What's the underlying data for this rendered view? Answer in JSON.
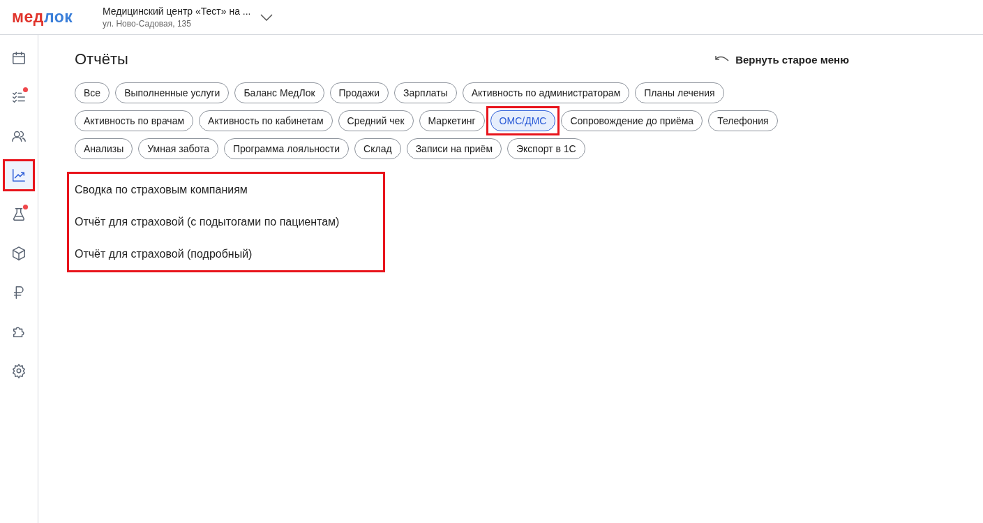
{
  "header": {
    "logo": {
      "part_1": "мед",
      "part_2": "лок"
    },
    "clinic_name": "Медицинский центр «Тест» на ...",
    "clinic_address": "ул. Ново-Садовая, 135"
  },
  "sidebar": {
    "items": [
      {
        "kind": "calendar",
        "selected": false,
        "notification": false,
        "highlighted": false
      },
      {
        "kind": "tasks",
        "selected": false,
        "notification": true,
        "highlighted": false
      },
      {
        "kind": "people",
        "selected": false,
        "notification": false,
        "highlighted": false
      },
      {
        "kind": "chart",
        "selected": true,
        "notification": false,
        "highlighted": true
      },
      {
        "kind": "flask",
        "selected": false,
        "notification": true,
        "highlighted": false
      },
      {
        "kind": "box",
        "selected": false,
        "notification": false,
        "highlighted": false
      },
      {
        "kind": "ruble",
        "selected": false,
        "notification": false,
        "highlighted": false
      },
      {
        "kind": "puzzle",
        "selected": false,
        "notification": false,
        "highlighted": false
      },
      {
        "kind": "gear",
        "selected": false,
        "notification": false,
        "highlighted": false
      }
    ]
  },
  "page": {
    "title": "Отчёты",
    "return_button": "Вернуть старое меню"
  },
  "filter_rows": [
    {
      "chips": [
        {
          "label": "Все",
          "selected": false,
          "highlighted": false
        },
        {
          "label": "Выполненные услуги",
          "selected": false,
          "highlighted": false
        },
        {
          "label": "Баланс МедЛок",
          "selected": false,
          "highlighted": false
        },
        {
          "label": "Продажи",
          "selected": false,
          "highlighted": false
        },
        {
          "label": "Зарплаты",
          "selected": false,
          "highlighted": false
        },
        {
          "label": "Активность по администраторам",
          "selected": false,
          "highlighted": false
        },
        {
          "label": "Планы лечения",
          "selected": false,
          "highlighted": false
        }
      ]
    },
    {
      "chips": [
        {
          "label": "Активность по врачам",
          "selected": false,
          "highlighted": false
        },
        {
          "label": "Активность по кабинетам",
          "selected": false,
          "highlighted": false
        },
        {
          "label": "Средний чек",
          "selected": false,
          "highlighted": false
        },
        {
          "label": "Маркетинг",
          "selected": false,
          "highlighted": false
        },
        {
          "label": "ОМС/ДМС",
          "selected": true,
          "highlighted": true
        },
        {
          "label": "Сопровождение до приёма",
          "selected": false,
          "highlighted": false
        },
        {
          "label": "Телефония",
          "selected": false,
          "highlighted": false
        }
      ]
    },
    {
      "chips": [
        {
          "label": "Анализы",
          "selected": false,
          "highlighted": false
        },
        {
          "label": "Умная забота",
          "selected": false,
          "highlighted": false
        },
        {
          "label": "Программа лояльности",
          "selected": false,
          "highlighted": false
        },
        {
          "label": "Склад",
          "selected": false,
          "highlighted": false
        },
        {
          "label": "Записи на приём",
          "selected": false,
          "highlighted": false
        },
        {
          "label": "Экспорт в 1С",
          "selected": false,
          "highlighted": false
        }
      ]
    }
  ],
  "reports": {
    "highlighted": true,
    "items": [
      "Сводка по страховым компаниям",
      "Отчёт для страховой (с подытогами по пациентам)",
      "Отчёт для страховой (подробный)"
    ]
  }
}
